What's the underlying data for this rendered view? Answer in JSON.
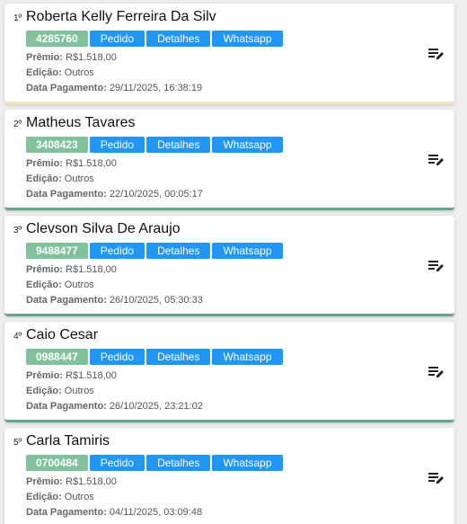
{
  "colors": {
    "code_badge": "#7fc29b",
    "action_button": "#2196f3",
    "first_card_accent": "#f2e6b8",
    "card_accent": "#5fa88a"
  },
  "icons": {
    "edit": "edit-note-icon"
  },
  "labels": {
    "premio": "Prêmio:",
    "edicao": "Edição:",
    "data_pagamento": "Data Pagamento:",
    "pedido": "Pedido",
    "detalhes": "Detalhes",
    "whatsapp": "Whatsapp"
  },
  "winners": [
    {
      "rank": "1º",
      "name": "Roberta Kelly Ferreira Da Silv",
      "code": "4285760",
      "premio": "R$1.518,00",
      "edicao": "Outros",
      "data_pagamento": "29/11/2025, 16:38:19"
    },
    {
      "rank": "2º",
      "name": "Matheus Tavares",
      "code": "3408423",
      "premio": "R$1.518,00",
      "edicao": "Outros",
      "data_pagamento": "22/10/2025, 00:05:17"
    },
    {
      "rank": "3º",
      "name": "Clevson Silva De Araujo",
      "code": "9488477",
      "premio": "R$1.518,00",
      "edicao": "Outros",
      "data_pagamento": "26/10/2025, 05:30:33"
    },
    {
      "rank": "4º",
      "name": "Caio Cesar",
      "code": "0988447",
      "premio": "R$1.518,00",
      "edicao": "Outros",
      "data_pagamento": "26/10/2025, 23:21:02"
    },
    {
      "rank": "5º",
      "name": "Carla Tamiris",
      "code": "0700484",
      "premio": "R$1.518,00",
      "edicao": "Outros",
      "data_pagamento": "04/11/2025, 03:09:48"
    }
  ]
}
